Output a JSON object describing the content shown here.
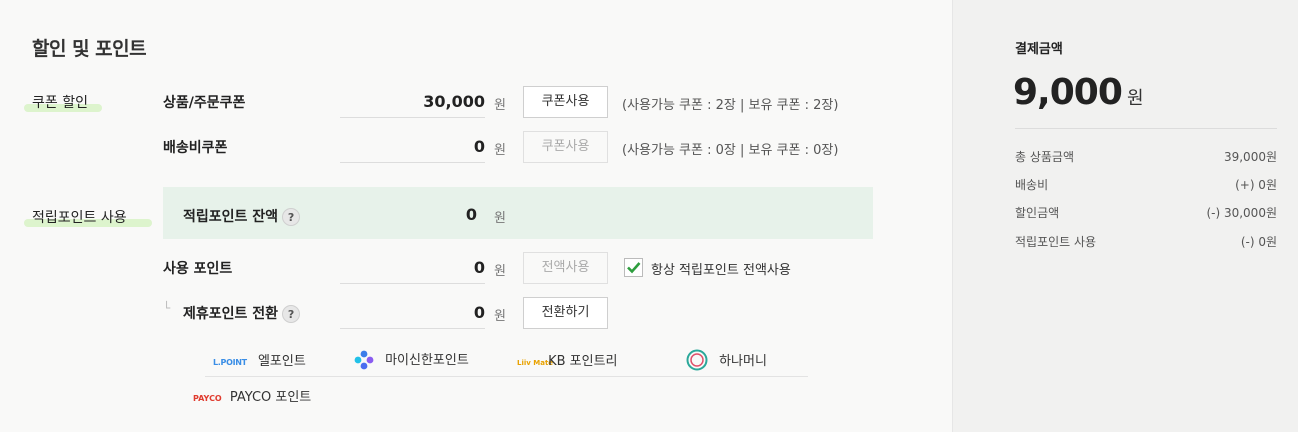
{
  "discount": {
    "title": "할인 및 포인트",
    "coupon_section": "쿠폰 할인",
    "rows": {
      "product_coupon": {
        "label": "상품/주문쿠폰",
        "value": "30,000",
        "unit": "원",
        "button": "쿠폰사용",
        "info": "(사용가능 쿠폰 : 2장 | 보유 쿠폰 : 2장)"
      },
      "shipping_coupon": {
        "label": "배송비쿠폰",
        "value": "0",
        "unit": "원",
        "button": "쿠폰사용",
        "info": "(사용가능 쿠폰 : 0장 | 보유 쿠폰 : 0장)"
      }
    },
    "points_section": "적립포인트 사용",
    "balance": {
      "label": "적립포인트 잔액",
      "help": "?",
      "value": "0",
      "unit": "원"
    },
    "use_points": {
      "label": "사용 포인트",
      "value": "0",
      "unit": "원",
      "button": "전액사용",
      "checkbox_label": "항상 적립포인트 전액사용",
      "checked": true
    },
    "partner_convert": {
      "prefix": "└",
      "label": "제휴포인트 전환",
      "help": "?",
      "value": "0",
      "unit": "원",
      "button": "전환하기"
    },
    "partners": [
      {
        "logo": "L.POINT",
        "name": "엘포인트",
        "icon": "lpoint-logo"
      },
      {
        "logo": "",
        "name": "마이신한포인트",
        "icon": "shinhan-logo"
      },
      {
        "logo": "Liiv Mate",
        "name": "KB 포인트리",
        "icon": "kb-liiv-logo"
      },
      {
        "logo": "",
        "name": "하나머니",
        "icon": "hana-money-logo"
      },
      {
        "logo": "PAYCO",
        "name": "PAYCO 포인트",
        "icon": "payco-logo"
      }
    ]
  },
  "summary": {
    "title": "결제금액",
    "amount": "9,000",
    "unit": "원",
    "rows": [
      {
        "label": "총 상품금액",
        "value": "39,000원"
      },
      {
        "label": "배송비",
        "value": "(+) 0원"
      },
      {
        "label": "할인금액",
        "value": "(-) 30,000원"
      },
      {
        "label": "적립포인트 사용",
        "value": "(-) 0원"
      }
    ]
  },
  "colors": {
    "highlight": "#d9f3c8",
    "balance_bg": "#e7f2ea",
    "check": "#2e9e3e"
  }
}
